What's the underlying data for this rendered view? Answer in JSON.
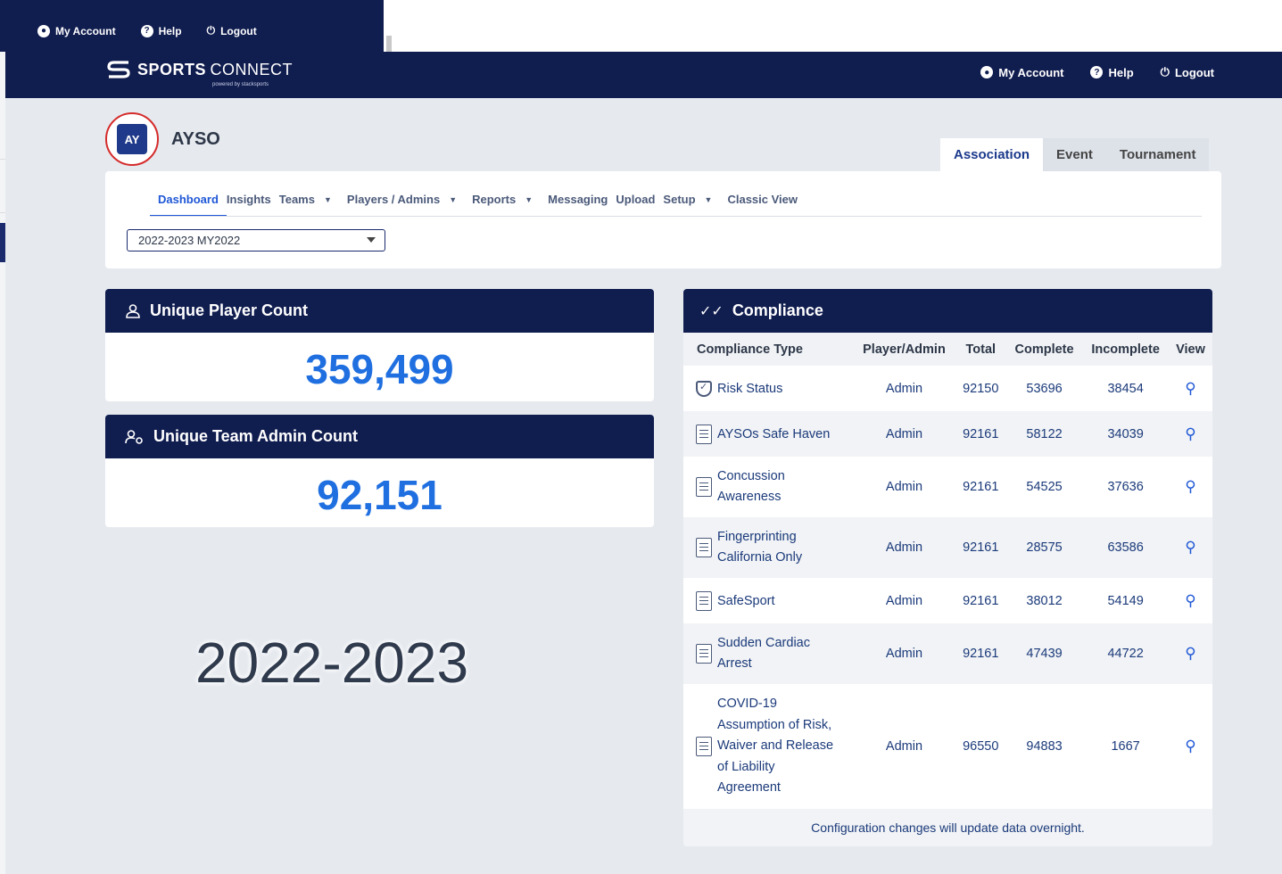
{
  "back_window": {
    "nav": [
      "My Account",
      "Help",
      "Logout"
    ]
  },
  "header": {
    "brand_bold": "SPORTS",
    "brand_light": "CONNECT",
    "brand_sub": "powered by stacksports",
    "nav": [
      "My Account",
      "Help",
      "Logout"
    ]
  },
  "org": {
    "name": "AYSO",
    "logo_text": "AY\nSO"
  },
  "type_tabs": [
    {
      "label": "Association",
      "active": true
    },
    {
      "label": "Event",
      "active": false
    },
    {
      "label": "Tournament",
      "active": false
    }
  ],
  "subnav": [
    {
      "label": "Dashboard",
      "dropdown": false,
      "active": true
    },
    {
      "label": "Insights",
      "dropdown": false
    },
    {
      "label": "Teams",
      "dropdown": true
    },
    {
      "label": "Players / Admins",
      "dropdown": true
    },
    {
      "label": "Reports",
      "dropdown": true
    },
    {
      "label": "Messaging",
      "dropdown": false
    },
    {
      "label": "Upload",
      "dropdown": false
    },
    {
      "label": "Setup",
      "dropdown": true
    },
    {
      "label": "Classic View",
      "dropdown": false
    }
  ],
  "season_select": {
    "value": "2022-2023 MY2022"
  },
  "player_card": {
    "title": "Unique Player Count",
    "value": "359,499"
  },
  "admin_card": {
    "title": "Unique Team Admin Count",
    "value": "92,151"
  },
  "watermark": "2022-2023",
  "compliance": {
    "title": "Compliance",
    "columns": [
      "Compliance Type",
      "Player/Admin",
      "Total",
      "Complete",
      "Incomplete",
      "View"
    ],
    "rows": [
      {
        "name": "Risk Status",
        "who": "Admin",
        "total": "92150",
        "complete": "53696",
        "incomplete": "38454",
        "icon": "shield-check-icon"
      },
      {
        "name": "AYSOs Safe Haven",
        "who": "Admin",
        "total": "92161",
        "complete": "58122",
        "incomplete": "34039",
        "icon": "course-icon"
      },
      {
        "name": "Concussion\nAwareness",
        "who": "Admin",
        "total": "92161",
        "complete": "54525",
        "incomplete": "37636",
        "icon": "course-icon"
      },
      {
        "name": "Fingerprinting\nCalifornia Only",
        "who": "Admin",
        "total": "92161",
        "complete": "28575",
        "incomplete": "63586",
        "icon": "course-icon"
      },
      {
        "name": "SafeSport",
        "who": "Admin",
        "total": "92161",
        "complete": "38012",
        "incomplete": "54149",
        "icon": "course-icon"
      },
      {
        "name": "Sudden Cardiac\nArrest",
        "who": "Admin",
        "total": "92161",
        "complete": "47439",
        "incomplete": "44722",
        "icon": "course-icon"
      },
      {
        "name": "COVID-19\nAssumption of Risk,\nWaiver and Release\nof Liability\nAgreement",
        "who": "Admin",
        "total": "96550",
        "complete": "94883",
        "incomplete": "1667",
        "icon": "document-icon"
      }
    ],
    "footer": "Configuration changes will update data overnight."
  },
  "colors": {
    "navy": "#101d4f",
    "accent_blue": "#1f6fe0",
    "link_blue": "#1f57d6"
  }
}
